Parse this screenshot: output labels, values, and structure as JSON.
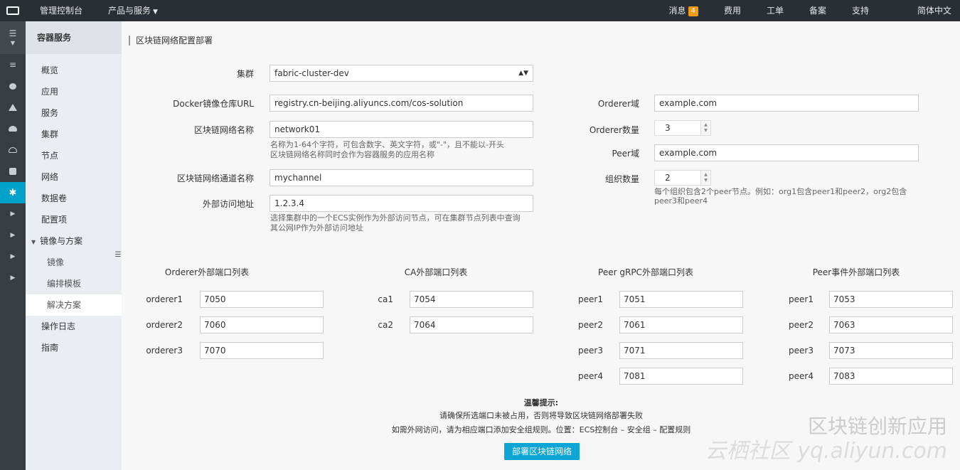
{
  "topbar": {
    "console": "管理控制台",
    "products": "产品与服务",
    "messages": "消息",
    "message_count": "4",
    "billing": "费用",
    "tickets": "工单",
    "icp": "备案",
    "support": "支持",
    "language": "简体中文"
  },
  "sidebar": {
    "title": "容器服务",
    "items": [
      "概览",
      "应用",
      "服务",
      "集群",
      "节点",
      "网络",
      "数据卷",
      "配置项"
    ],
    "group": "镜像与方案",
    "sub_items": [
      "镜像",
      "编排模板",
      "解决方案"
    ],
    "bottom_items": [
      "操作日志",
      "指南"
    ]
  },
  "page": {
    "title": "区块链网络配置部署"
  },
  "form": {
    "cluster_label": "集群",
    "cluster_value": "fabric-cluster-dev",
    "registry_label": "Docker镜像仓库URL",
    "registry_value": "registry.cn-beijing.aliyuncs.com/cos-solution",
    "network_name_label": "区块链网络名称",
    "network_name_value": "network01",
    "network_name_help1": "名称为1-64个字符，可包含数字、英文字符，或\"-\"，且不能以-开头",
    "network_name_help2": "区块链网络名称同时会作为容器服务的应用名称",
    "channel_label": "区块链网络通道名称",
    "channel_value": "mychannel",
    "external_addr_label": "外部访问地址",
    "external_addr_value": "1.2.3.4",
    "external_addr_help1": "选择集群中的一个ECS实例作为外部访问节点，可在集群节点列表中查询",
    "external_addr_help2": "其公网IP作为外部访问地址",
    "orderer_domain_label": "Orderer域",
    "orderer_domain_value": "example.com",
    "orderer_count_label": "Orderer数量",
    "orderer_count_value": "3",
    "peer_domain_label": "Peer域",
    "peer_domain_value": "example.com",
    "org_count_label": "组织数量",
    "org_count_value": "2",
    "org_help1": "每个组织包含2个peer节点。例如：org1包含peer1和peer2，org2包含",
    "org_help2": "peer3和peer4"
  },
  "ports": {
    "orderer": {
      "heading": "Orderer外部端口列表",
      "rows": [
        {
          "name": "orderer1",
          "port": "7050"
        },
        {
          "name": "orderer2",
          "port": "7060"
        },
        {
          "name": "orderer3",
          "port": "7070"
        }
      ]
    },
    "ca": {
      "heading": "CA外部端口列表",
      "rows": [
        {
          "name": "ca1",
          "port": "7054"
        },
        {
          "name": "ca2",
          "port": "7064"
        }
      ]
    },
    "peer_grpc": {
      "heading": "Peer gRPC外部端口列表",
      "rows": [
        {
          "name": "peer1",
          "port": "7051"
        },
        {
          "name": "peer2",
          "port": "7061"
        },
        {
          "name": "peer3",
          "port": "7071"
        },
        {
          "name": "peer4",
          "port": "7081"
        }
      ]
    },
    "peer_event": {
      "heading": "Peer事件外部端口列表",
      "rows": [
        {
          "name": "peer1",
          "port": "7053"
        },
        {
          "name": "peer2",
          "port": "7063"
        },
        {
          "name": "peer3",
          "port": "7073"
        },
        {
          "name": "peer4",
          "port": "7083"
        }
      ]
    }
  },
  "tips": {
    "title": "温馨提示:",
    "line1": "请确保所选端口未被占用，否则将导致区块链网络部署失败",
    "line2": "如需外网访问，请为相应端口添加安全组规则。位置：ECS控制台 – 安全组 – 配置规则"
  },
  "deploy_button": "部署区块链网络",
  "watermark": {
    "line1": "区块链创新应用",
    "line2": "云栖社区 yq.aliyun.com"
  },
  "colors": {
    "topbar_bg": "#2a2f36",
    "rail_bg": "#373d41",
    "accent": "#00a2ca",
    "badge": "#f39c12",
    "button": "#0ca5d4"
  }
}
